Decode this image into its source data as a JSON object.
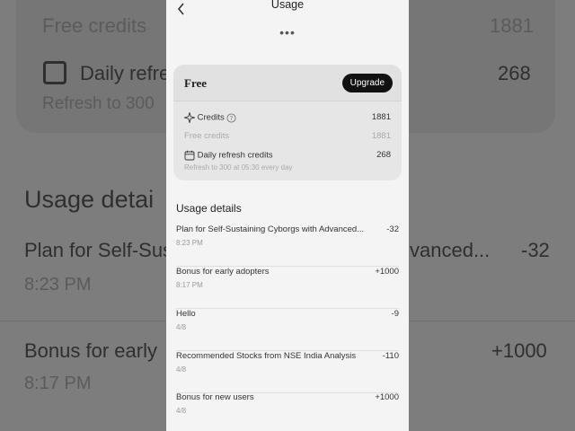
{
  "background": {
    "free_credits_label": "Free credits",
    "free_credits_value": "1881",
    "daily_refresh_label": "Daily refre",
    "daily_refresh_value": "268",
    "refresh_note": "Refresh to 300",
    "usage_details_heading": "Usage detai",
    "item1_name_left": "Plan for Self-Sus",
    "item1_name_right": "vanced...",
    "item1_amount": "-32",
    "item1_time": "8:23 PM",
    "item2_name": "Bonus for early",
    "item2_amount": "+1000",
    "item2_time": "8:17 PM"
  },
  "header": {
    "back_icon": "chevron-left-icon",
    "title": "Usage",
    "more_icon": "ellipsis-icon",
    "more_glyph": "•••"
  },
  "plan_card": {
    "plan_name": "Free",
    "upgrade_label": "Upgrade",
    "credits_label": "Credits",
    "credits_value": "1881",
    "free_credits_label": "Free credits",
    "free_credits_value": "1881",
    "daily_refresh_label": "Daily refresh credits",
    "daily_refresh_value": "268",
    "refresh_note": "Refresh to 300 at 05:30 every day"
  },
  "usage": {
    "heading": "Usage details",
    "items": [
      {
        "name": "Plan for Self-Sustaining Cyborgs with Advanced...",
        "amount": "-32",
        "time": "8:23 PM"
      },
      {
        "name": "Bonus for early adopters",
        "amount": "+1000",
        "time": "8:17 PM"
      },
      {
        "name": "Hello",
        "amount": "-9",
        "time": "4/8"
      },
      {
        "name": "Recommended Stocks from NSE India Analysis",
        "amount": "-110",
        "time": "4/8"
      },
      {
        "name": "Bonus for new users",
        "amount": "+1000",
        "time": "4/8"
      }
    ]
  }
}
